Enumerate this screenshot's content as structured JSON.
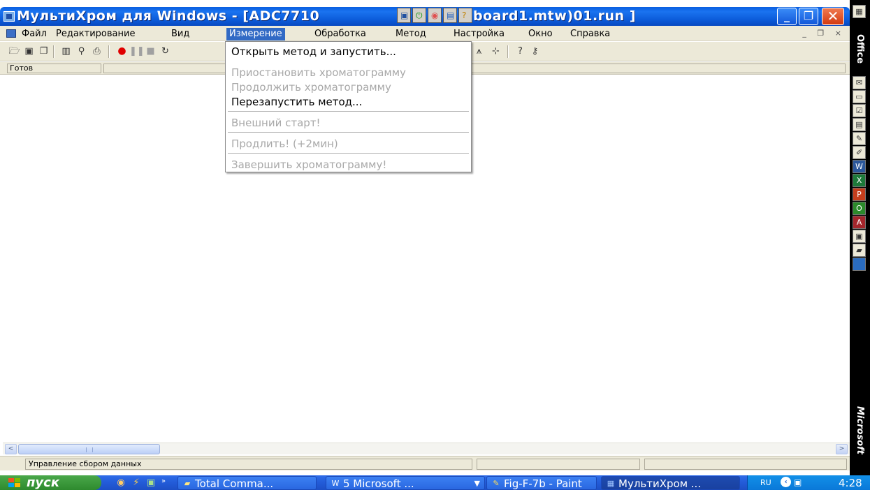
{
  "window": {
    "title_left": "МультиХром для Windows - [ADC7710",
    "title_right": "board1.mtw)01.run ]",
    "controls": {
      "minimize": "_",
      "maximize": "❐",
      "close": "✕"
    }
  },
  "menubar": {
    "items": [
      {
        "label": "Файл"
      },
      {
        "label": "Редактирование"
      },
      {
        "label": "Вид"
      },
      {
        "label": "Измерение",
        "active": true
      },
      {
        "label": "Обработка"
      },
      {
        "label": "Метод"
      },
      {
        "label": "Настройка"
      },
      {
        "label": "Окно"
      },
      {
        "label": "Справка"
      }
    ],
    "mdi_controls": "_ ❐ ×"
  },
  "status_strip": {
    "text": "Готов"
  },
  "dropdown": {
    "menu": "Измерение",
    "items": [
      {
        "label": "Открыть метод и запустить...",
        "enabled": true
      },
      {
        "label": "Приостановить хроматограмму",
        "enabled": false
      },
      {
        "label": "Продолжить хроматограмму",
        "enabled": false
      },
      {
        "label": "Перезапустить метод...",
        "enabled": true
      },
      {
        "label": "Внешний старт!",
        "enabled": false
      },
      {
        "label": "Продлить! (+2мин)",
        "enabled": false
      },
      {
        "label": "Завершить хроматограмму!",
        "enabled": false
      }
    ]
  },
  "scrollbar": {
    "grip": "III",
    "left_arrow": "<",
    "right_arrow": ">"
  },
  "statusbar": {
    "text": "Управление сбором данных"
  },
  "officebar": {
    "top_label": "Office",
    "bottom_label": "Microsoft"
  },
  "taskbar": {
    "start_label": "пуск",
    "tasks": [
      {
        "label": "Total Comma...",
        "icon": "total-commander-icon"
      },
      {
        "label": "5 Microsoft ...",
        "icon": "word-icon",
        "has_dropdown": true
      },
      {
        "label": "Fig-F-7b - Paint",
        "icon": "paint-icon"
      },
      {
        "label": "МультиХром ...",
        "icon": "multichrom-icon",
        "active": true
      }
    ],
    "tray": {
      "language": "RU",
      "clock": "4:28"
    }
  },
  "colors": {
    "title_gradient": "#0a5fe0",
    "menu_highlight": "#316ac5",
    "disabled_text": "#a8a8a8",
    "taskbar": "#245edb",
    "start_button": "#3c9a3c"
  }
}
